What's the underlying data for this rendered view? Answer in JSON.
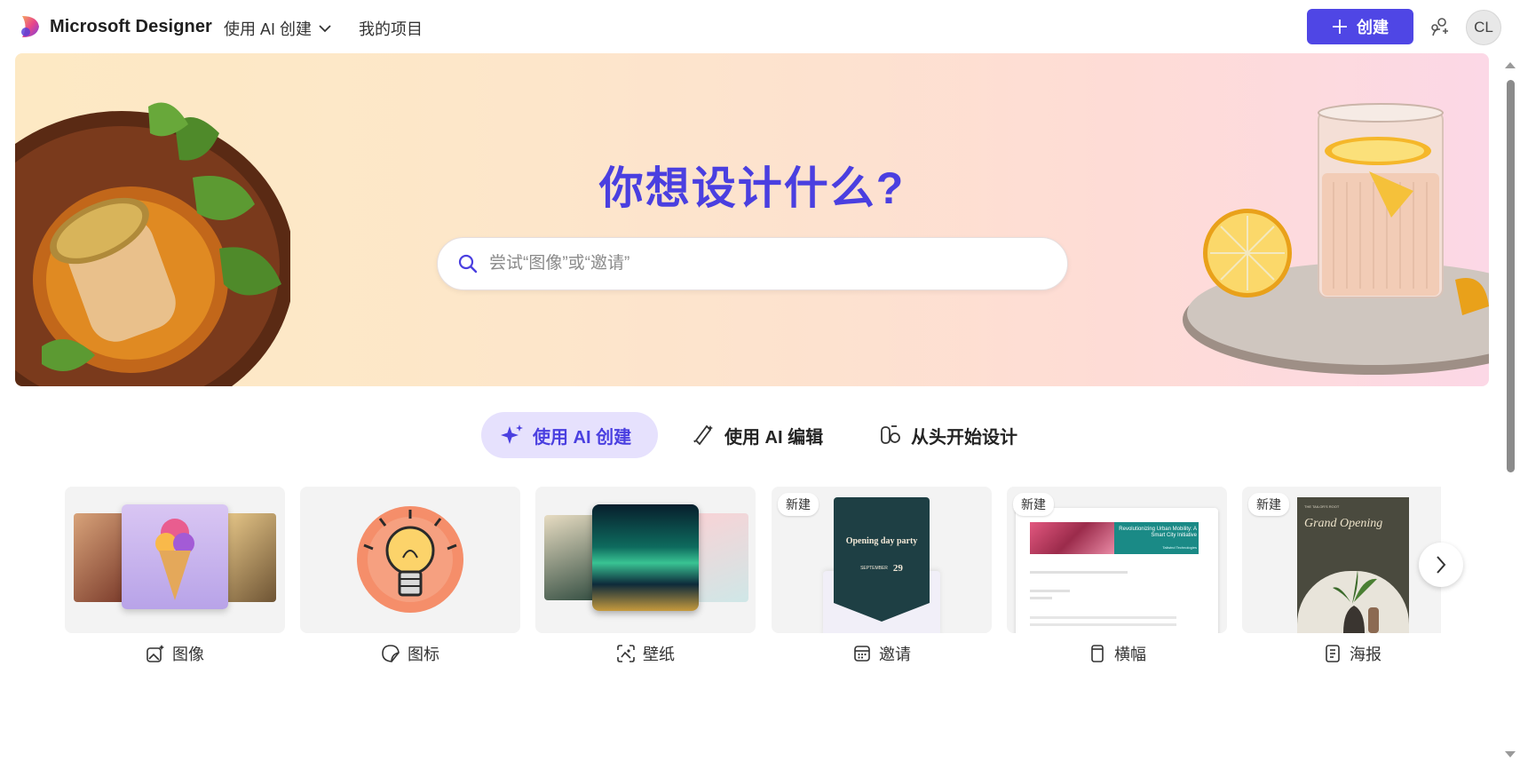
{
  "app": {
    "name": "Microsoft Designer",
    "logo_icon": "microsoft-designer-logo",
    "brand_color": "#4f46e5"
  },
  "nav": {
    "create_with_ai": "使用 AI 创建",
    "my_projects": "我的项目"
  },
  "header": {
    "create_button_label": "创建",
    "avatar_initials": "CL"
  },
  "hero": {
    "title": "你想设计什么?",
    "search_placeholder": "尝试“图像”或“邀请”"
  },
  "tabs": [
    {
      "label": "使用 AI 创建",
      "icon": "sparkle-icon",
      "active": true
    },
    {
      "label": "使用 AI 编辑",
      "icon": "magic-pen-icon",
      "active": false
    },
    {
      "label": "从头开始设计",
      "icon": "design-shapes-icon",
      "active": false
    }
  ],
  "cards": [
    {
      "label": "图像",
      "icon": "image-sparkle-icon",
      "badge": ""
    },
    {
      "label": "图标",
      "icon": "sticker-icon",
      "badge": ""
    },
    {
      "label": "壁纸",
      "icon": "wallpaper-icon",
      "badge": ""
    },
    {
      "label": "邀请",
      "icon": "calendar-icon",
      "badge": "新建",
      "preview": {
        "title": "Opening day party",
        "month": "SEPTEMBER",
        "day": "29"
      }
    },
    {
      "label": "横幅",
      "icon": "banner-icon",
      "badge": "新建",
      "preview": {
        "headline": "Revolutionizing Urban Mobility: A Smart City Initiative",
        "sub": "Tailwind Technologies"
      }
    },
    {
      "label": "海报",
      "icon": "poster-icon",
      "badge": "新建",
      "preview": {
        "header": "THE TAILOR'S ROOT",
        "title": "Grand Opening"
      }
    }
  ]
}
